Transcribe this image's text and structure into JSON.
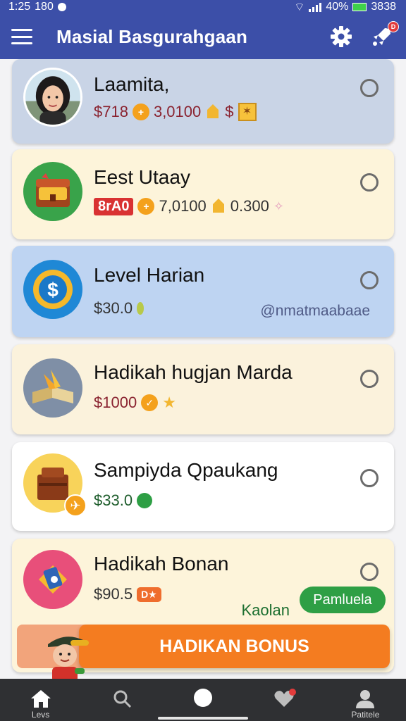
{
  "status_bar": {
    "time": "1:25",
    "extra": "180",
    "battery_pct": "40%",
    "right_value": "3838"
  },
  "app": {
    "title": "Masial Basgurahgaan",
    "notification_badge": "D"
  },
  "tasks": [
    {
      "title": "Laamita,",
      "amount": "$718",
      "coins": "3,0100",
      "extra": "$",
      "icon": "avatar-photo",
      "bg": "#c9d4e6"
    },
    {
      "title": "Eest Utaay",
      "tag": "8rA0",
      "coins": "7,0100",
      "gems": "0.300",
      "icon": "treasure-chest-icon",
      "bg": "#fdf4da"
    },
    {
      "title": "Level Harian",
      "amount": "$30.0",
      "handle": "@nmatmaabaae",
      "icon": "dollar-sun-icon",
      "bg": "#bed4f2"
    },
    {
      "title": "Hadikah hugjan Marda",
      "amount": "$1000",
      "icon": "book-icon",
      "bg": "#fbf2dc"
    },
    {
      "title": "Sampiyda Qpaukang",
      "amount": "$33.0",
      "icon": "crate-icon",
      "bg": "#ffffff"
    },
    {
      "title": "Hadikah Bonan",
      "amount": "$90.5",
      "badge": "D★",
      "side_text": "Kaolan",
      "pill_label": "Pamluela",
      "icon": "ticket-icon",
      "bg": "#fdf4da"
    }
  ],
  "bonus_button": "HADIKAN BONUS",
  "nav": [
    {
      "label": "Levs",
      "icon": "home-icon"
    },
    {
      "label": "",
      "icon": "search-icon"
    },
    {
      "label": "",
      "icon": "center-dot-icon"
    },
    {
      "label": "",
      "icon": "heart-icon"
    },
    {
      "label": "Patitele",
      "icon": "profile-icon"
    }
  ],
  "colors": {
    "app_bar": "#3c4fa8",
    "accent_orange": "#f47c20",
    "pill_green": "#2e9f45",
    "bottom_nav": "#2f3033"
  }
}
